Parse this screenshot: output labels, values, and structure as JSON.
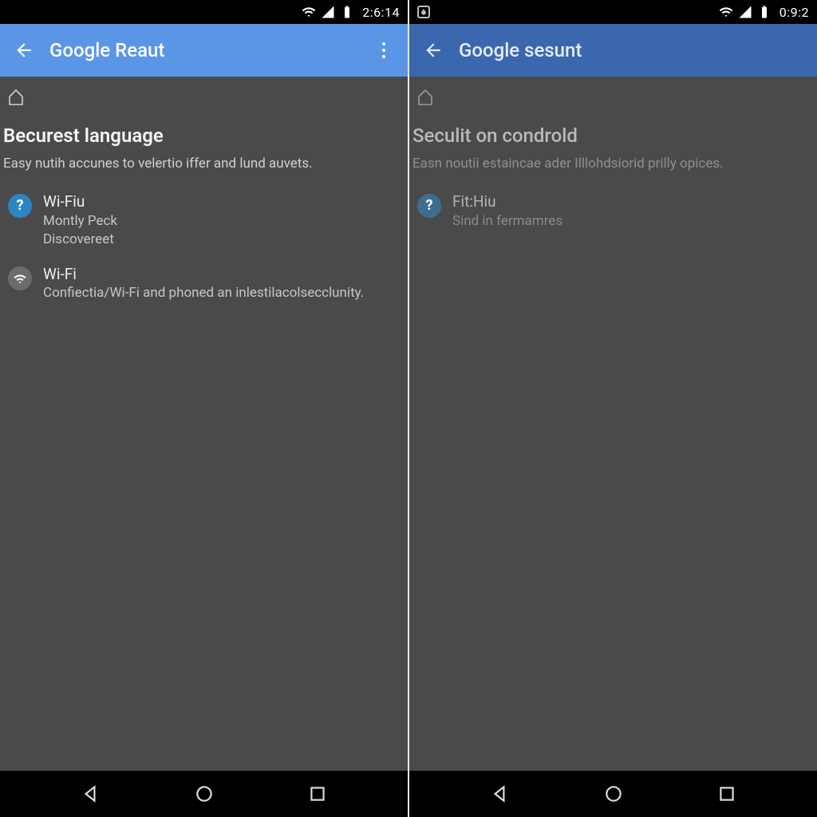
{
  "left": {
    "status": {
      "time": "2:6:14"
    },
    "appbar": {
      "title": "Google Reaut"
    },
    "section": {
      "heading": "Becurest language",
      "subtext": "Easy nutih accunes to velertio iffer and lund auvets."
    },
    "items": [
      {
        "icon_glyph": "?",
        "title": "Wi-Fiu",
        "line1": "Montly Peck",
        "line2": "Discovereet"
      },
      {
        "title": "Wi-Fi",
        "line1": "Confiectia/Wi-Fi and phoned an inlestilacolsecclunity."
      }
    ]
  },
  "right": {
    "status": {
      "time": "0:9:2"
    },
    "appbar": {
      "title": "Google sesunt"
    },
    "section": {
      "heading": "Seculit on condrold",
      "subtext": "Easn noutii estaincae ader Illlohdsiorid prilly opices."
    },
    "items": [
      {
        "icon_glyph": "?",
        "title": "Fit:Hiu",
        "line1": "Sind in fermamres"
      }
    ]
  }
}
